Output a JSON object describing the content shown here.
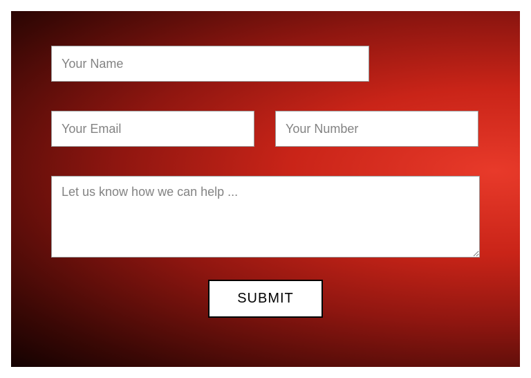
{
  "form": {
    "name": {
      "placeholder": "Your Name",
      "value": ""
    },
    "email": {
      "placeholder": "Your Email",
      "value": ""
    },
    "number": {
      "placeholder": "Your Number",
      "value": ""
    },
    "message": {
      "placeholder": "Let us know how we can help ...",
      "value": ""
    },
    "submit_label": "SUBMIT"
  },
  "colors": {
    "gradient_light": "#e83a2a",
    "gradient_dark": "#140201",
    "input_bg": "#ffffff",
    "placeholder": "#838383",
    "button_border": "#000000"
  }
}
